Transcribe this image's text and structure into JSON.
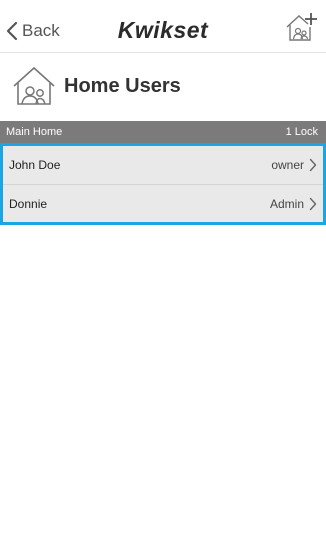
{
  "navbar": {
    "back_label": "Back",
    "brand": "Kwikset",
    "add_home_icon": "home-plus-icon"
  },
  "header": {
    "icon": "home-users-icon",
    "title": "Home Users"
  },
  "section": {
    "home_name": "Main Home",
    "lock_count": "1 Lock"
  },
  "users": [
    {
      "name": "John Doe",
      "role": "owner"
    },
    {
      "name": "Donnie",
      "role": "Admin"
    }
  ],
  "colors": {
    "accent": "#1aa6e5",
    "section_bar": "#7b7b7b",
    "row_bg": "#e9e9e9"
  }
}
